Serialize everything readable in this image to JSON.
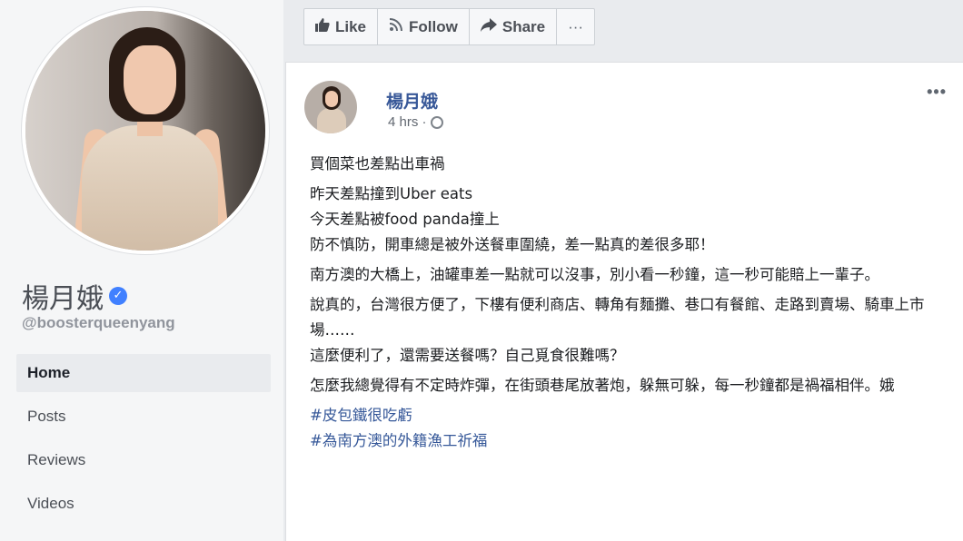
{
  "sidebar": {
    "page_name": "楊月娥",
    "verified_mark": "✓",
    "handle": "@boosterqueenyang",
    "nav": [
      {
        "label": "Home",
        "active": true
      },
      {
        "label": "Posts",
        "active": false
      },
      {
        "label": "Reviews",
        "active": false
      },
      {
        "label": "Videos",
        "active": false
      }
    ]
  },
  "action_bar": {
    "like": "Like",
    "follow": "Follow",
    "share": "Share",
    "more": "···"
  },
  "post": {
    "author": "楊月娥",
    "time": "4 hrs ·",
    "menu": "•••",
    "paragraphs": [
      "買個菜也差點出車禍",
      "昨天差點撞到Uber eats\n今天差點被food panda撞上\n防不慎防，開車總是被外送餐車圍繞，差一點真的差很多耶！",
      "南方澳的大橋上，油罐車差一點就可以沒事，別小看一秒鐘，這一秒可能賠上一輩子。",
      "說真的，台灣很方便了，下樓有便利商店、轉角有麵攤、巷口有餐館、走路到賣場、騎車上市場……\n這麼便利了，還需要送餐嗎？自己覓食很難嗎？",
      "怎麼我總覺得有不定時炸彈，在街頭巷尾放著炮，躲無可躲，每一秒鐘都是禍福相伴。娥"
    ],
    "hashtags": [
      "#皮包鐵很吃虧",
      "#為南方澳的外籍漁工祈福"
    ]
  },
  "colors": {
    "link": "#385898",
    "verified": "#4080ff",
    "background": "#e9ebee"
  }
}
